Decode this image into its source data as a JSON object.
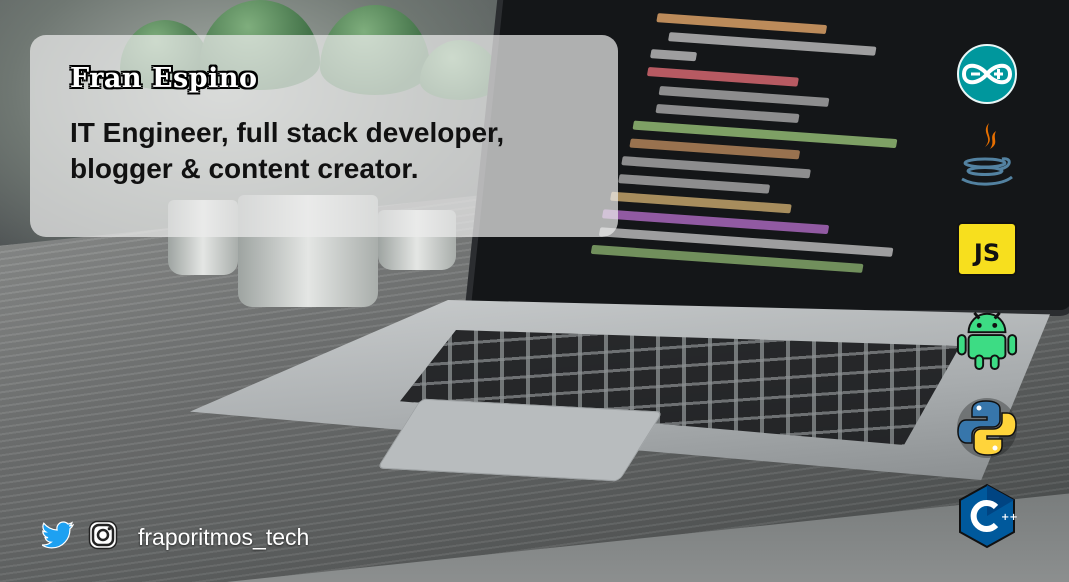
{
  "card": {
    "name": "Fran Espino",
    "description": "IT Engineer, full stack developer, blogger & content creator."
  },
  "tech_icons": [
    {
      "icon": "arduino-icon",
      "color": "#00979D"
    },
    {
      "icon": "java-icon",
      "color": "#E76F00"
    },
    {
      "icon": "javascript-icon",
      "label": "JS",
      "color": "#F7DF1E"
    },
    {
      "icon": "android-icon",
      "color": "#3DDC84"
    },
    {
      "icon": "python-icon",
      "color": "#3776AB"
    },
    {
      "icon": "cpp-icon",
      "color": "#00599C"
    }
  ],
  "social": {
    "handle": "fraporitmos_tech",
    "icons": [
      "twitter-icon",
      "instagram-icon"
    ]
  },
  "colors": {
    "card_bg": "#ebecec",
    "twitter": "#1DA1F2"
  }
}
